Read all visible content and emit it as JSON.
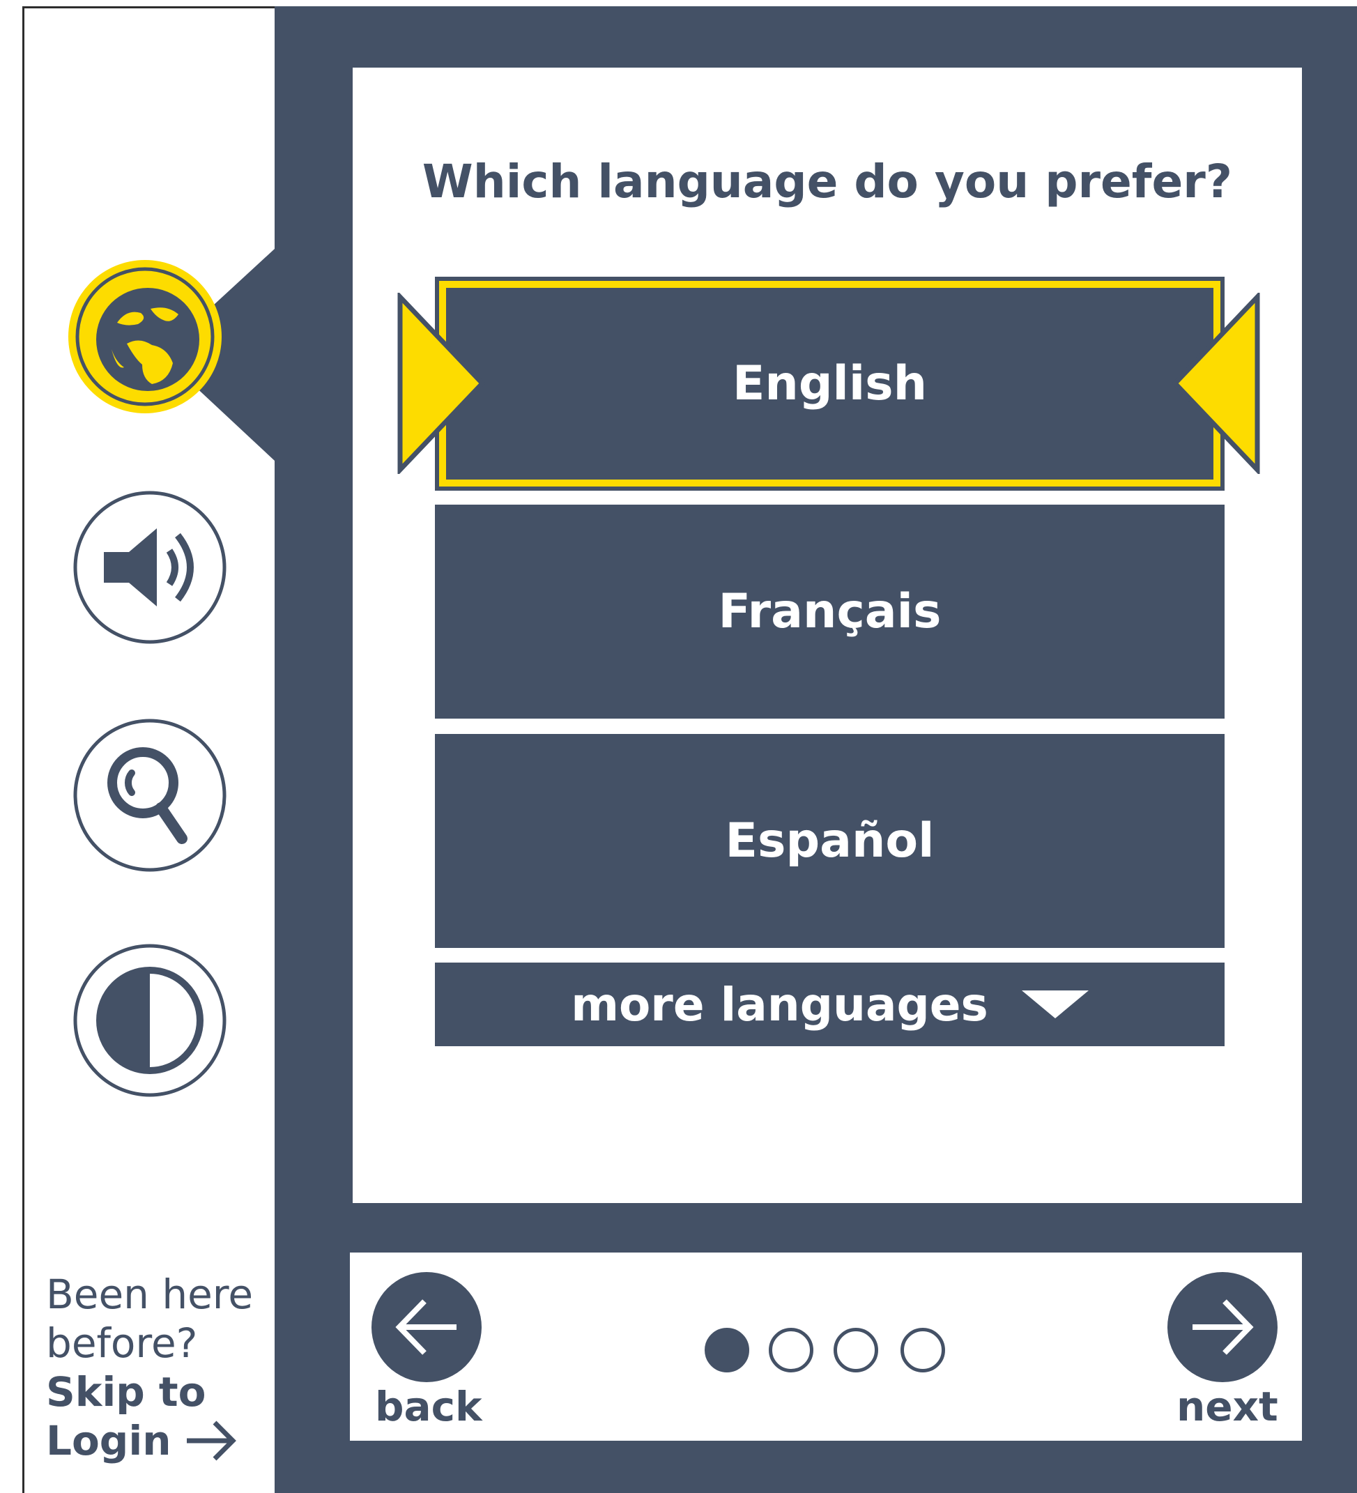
{
  "question": "Which language do you prefer?",
  "languages": [
    {
      "label": "English",
      "selected": true
    },
    {
      "label": "Français",
      "selected": false
    },
    {
      "label": "Español",
      "selected": false
    }
  ],
  "more_languages": "more languages",
  "sidebar": {
    "icons": [
      "globe-icon",
      "speaker-icon",
      "magnifier-icon",
      "contrast-icon"
    ],
    "active_icon": "globe-icon",
    "been_here_line1": "Been here",
    "been_here_line2": "before?",
    "skip_line1": "Skip to",
    "skip_line2": "Login"
  },
  "nav": {
    "back_label": "back",
    "next_label": "next",
    "steps_total": 4,
    "current_step": 1
  },
  "colors": {
    "primary": "#445166",
    "accent": "#fddc00",
    "background": "#ffffff"
  }
}
